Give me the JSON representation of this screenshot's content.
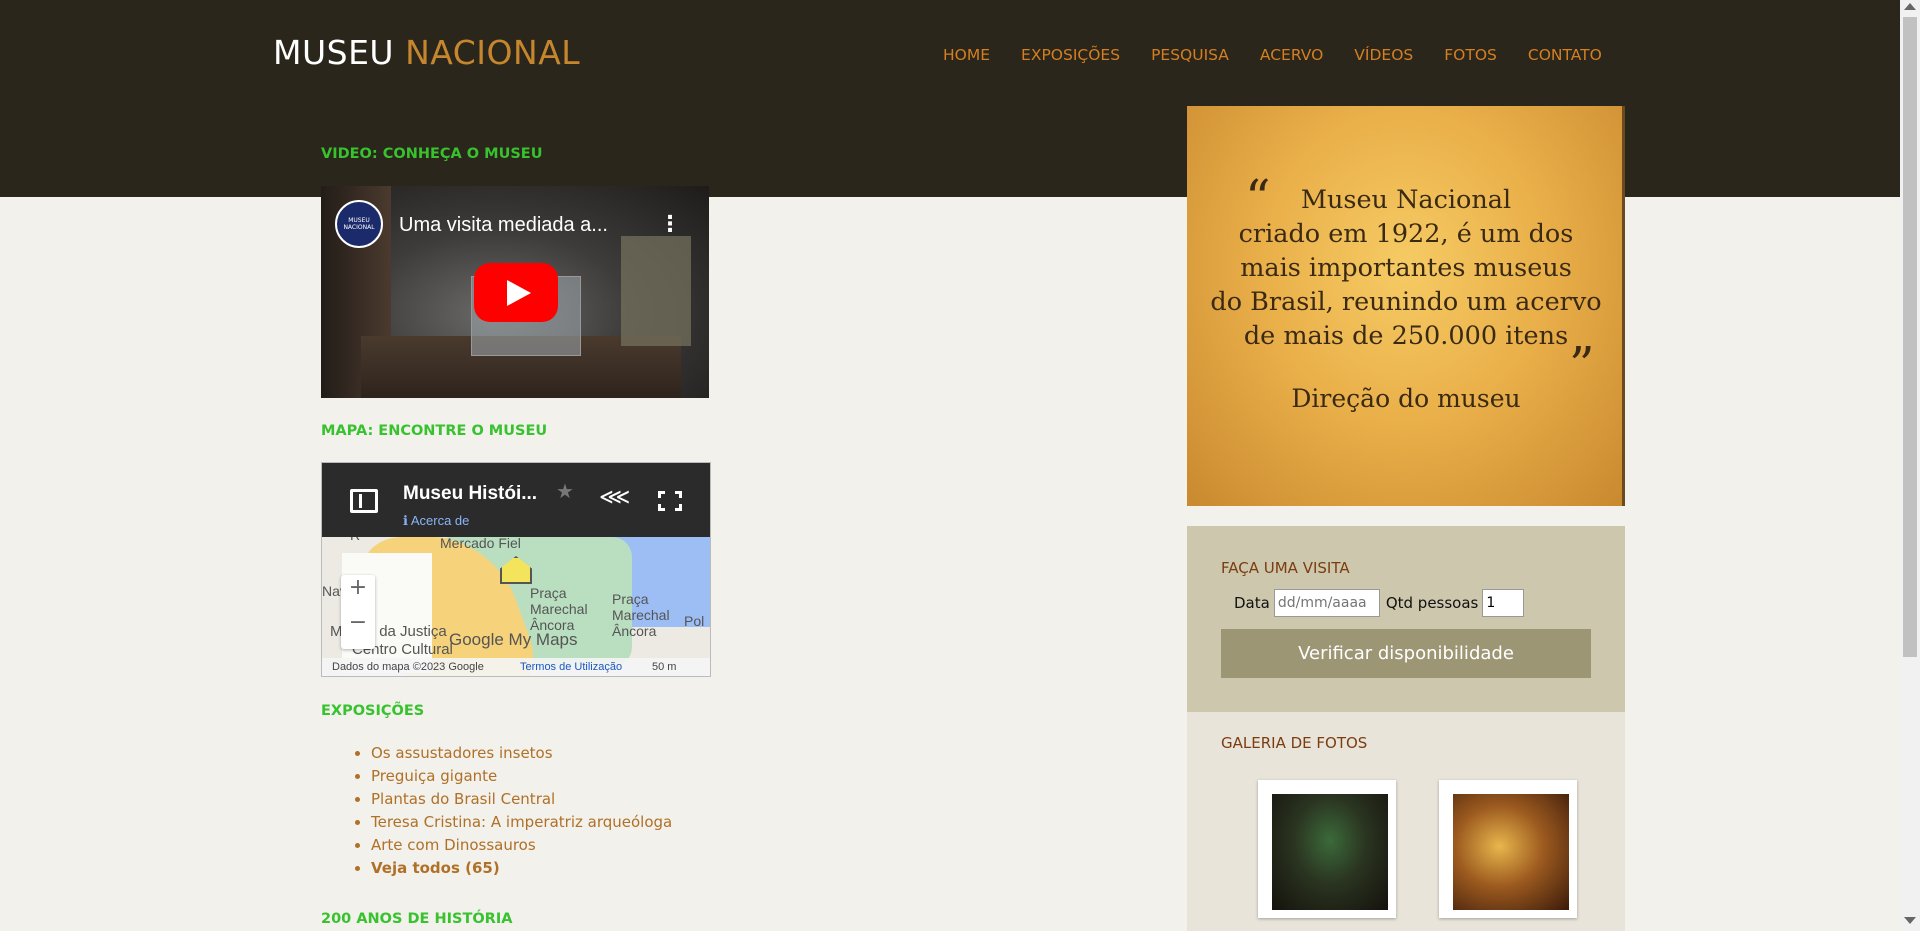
{
  "logo": {
    "part1": "MUSEU",
    "part2": "NACIONAL"
  },
  "nav": [
    "HOME",
    "EXPOSIÇÕES",
    "PESQUISA",
    "ACERVO",
    "VÍDEOS",
    "FOTOS",
    "CONTATO"
  ],
  "video_section": {
    "title": "VIDEO: CONHEÇA O MUSEU",
    "video_title": "Uma visita mediada a...",
    "channel": "MUSEU NACIONAL"
  },
  "map_section": {
    "title": "MAPA: ENCONTRE O MUSEU",
    "map_title": "Museu Histói...",
    "about": "Acerca de",
    "labels": [
      "Mercado Fiel",
      "Praça Marechal Âncora",
      "Praça Marechal Âncora",
      "Museu da Justiça",
      "Centro Cultural",
      "Nav",
      "Pol",
      "R"
    ],
    "brand": "Google My Maps",
    "footer_data": "Dados do mapa ©2023 Google",
    "footer_terms": "Termos de Utilização",
    "footer_scale": "50 m"
  },
  "exposicoes": {
    "title": "EXPOSIÇÕES",
    "items": [
      "Os assustadores insetos",
      "Preguiça gigante",
      "Plantas do Brasil Central",
      "Teresa Cristina: A imperatriz arqueóloga",
      "Arte com Dinossauros",
      "Veja todos (65)"
    ]
  },
  "historia": {
    "title": "200 ANOS DE HISTÓRIA"
  },
  "quote": {
    "text_lines": [
      "Museu Nacional",
      "criado em 1922, é um dos",
      "mais importantes museus",
      "do Brasil, reunindo um acervo",
      "de mais de 250.000 itens"
    ],
    "signature": "Direção do museu"
  },
  "visita": {
    "title": "FAÇA UMA VISITA",
    "date_label": "Data",
    "date_placeholder": "dd/mm/aaaa",
    "qty_label": "Qtd pessoas",
    "qty_value": "1",
    "button": "Verificar disponibilidade"
  },
  "galeria": {
    "title": "GALERIA DE FOTOS"
  },
  "colors": {
    "header": "#2a261b",
    "nav": "#d47f21",
    "section_title": "#37c22e",
    "link": "#b07027",
    "accent_brown": "#7a3d0f"
  }
}
